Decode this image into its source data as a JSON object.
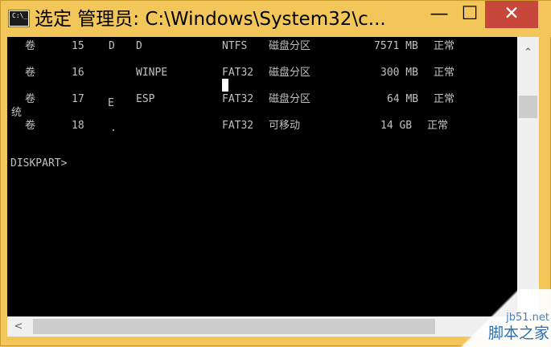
{
  "window": {
    "title": "选定 管理员: C:\\Windows\\System32\\c...",
    "icon_text": "C:\\_",
    "controls": {
      "minimize_icon": "—",
      "maximize_icon": "☐",
      "close_icon": "✕"
    }
  },
  "console": {
    "rows": [
      {
        "type": "卷",
        "num": "15",
        "ltr": "D",
        "label": "D",
        "fs": "NTFS",
        "kind": "磁盘分区",
        "size": "7571 MB",
        "status": "正常"
      },
      {
        "type": "卷",
        "num": "16",
        "ltr": "",
        "label": "WINPE",
        "fs": "FAT32",
        "kind": "磁盘分区",
        "size": "300 MB",
        "status": "正常"
      },
      {
        "type": "卷",
        "num": "17",
        "ltr": "",
        "label": "ESP",
        "fs": "FAT32",
        "kind": "磁盘分区",
        "size": "64 MB",
        "status": "正常"
      },
      {
        "type": "卷",
        "num": "18",
        "ltr": "",
        "label": "",
        "fs": "FAT32",
        "kind": "可移动",
        "size": "14 GB",
        "status": "正常"
      }
    ],
    "stray_tong": "统",
    "stray_E": "E",
    "stray_dot": ".",
    "prompt": "DISKPART>"
  },
  "scrollbars": {
    "up_icon": "⌃",
    "left_icon": "<"
  },
  "watermark": {
    "line1": "jb51.net",
    "line2": "脚本之家"
  }
}
